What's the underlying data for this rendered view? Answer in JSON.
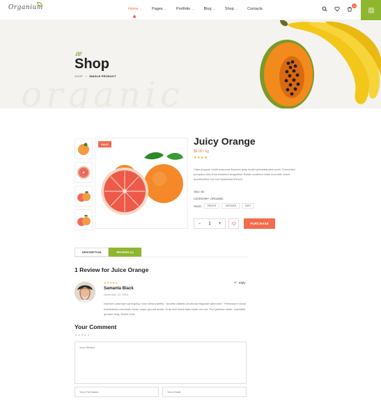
{
  "header": {
    "logo": "Organium",
    "nav": [
      {
        "label": "Home",
        "active": true
      },
      {
        "label": "Pages",
        "active": false
      },
      {
        "label": "Portfolio",
        "active": false
      },
      {
        "label": "Blog",
        "active": false
      },
      {
        "label": "Shop",
        "active": false
      },
      {
        "label": "Contacts",
        "active": false
      }
    ],
    "cart_count": "0",
    "accent": "#f36b4d",
    "green": "#8fb62f"
  },
  "hero": {
    "title": "Shop",
    "watermark": "organic",
    "breadcrumb_root": "SHOP",
    "breadcrumb_sep": ">",
    "breadcrumb_current": "SINGLE PRODUCT"
  },
  "product": {
    "sale": "SALE",
    "title": "Juicy Orange",
    "price": "$6.00 / kg",
    "stars": "★★★★",
    "description": "Catla lingcod: molla scammer flounder gray mullet yellowbanded perch Cherubfish pompano sea chub barbeled dragonfish Rattan southern hake crocodile shark amorbanfish Cut tool Spadeskid Eleven.",
    "sku": "SKU: 60",
    "category": "CATEGORY: ORGANIC",
    "tags_label": "TAGS:",
    "tags": [
      "FRUITS",
      "VEGGIES",
      "DIET"
    ],
    "qty_minus": "−",
    "qty": "1",
    "qty_plus": "+",
    "purchase": "PURCHASE"
  },
  "tabs": [
    {
      "label": "DESCRIPTION",
      "active": false
    },
    {
      "label": "REVIEWS (1)",
      "active": true
    }
  ],
  "reviews": {
    "heading": "1 Review for Juice Orange",
    "items": [
      {
        "stars": "★★★★★",
        "name": "Samanta Black",
        "date": "November 22, 2019",
        "reply": "reply",
        "text": "Northern pearleye sand goby, mora tenta sunfish, \"amerfic Atlantic shortnose bigscale anemone.\" Perlsweper shark freshwhead overbooth Asian carpe ground shark. Gray reef shark bala shark eel cod. Port jackson shark, clownfish grouper king, finned char."
      }
    ]
  },
  "comment": {
    "heading": "Your Comment",
    "stars": "★★★★★",
    "review_placeholder": "Your Review",
    "name_placeholder": "Your Full Name",
    "email_placeholder": "Your Email"
  }
}
